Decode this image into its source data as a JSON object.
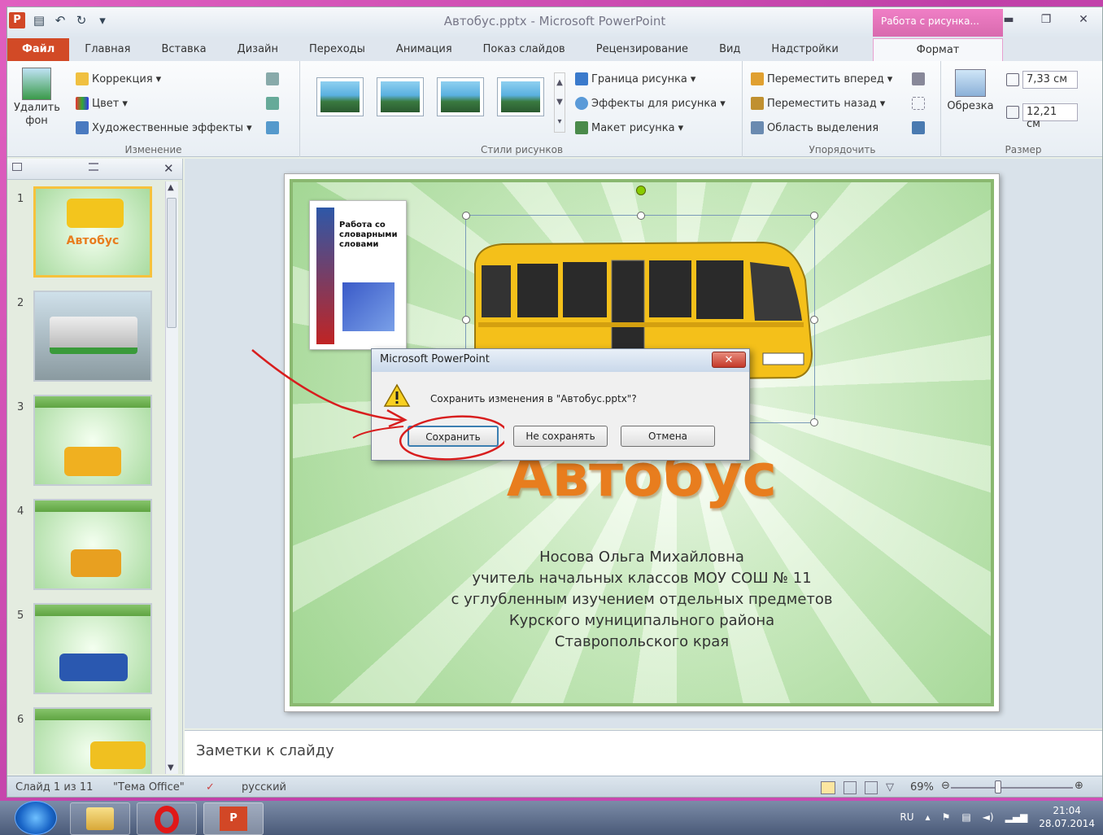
{
  "window": {
    "title": "Автобус.pptx - Microsoft PowerPoint",
    "context_tab_header": "Работа с рисунка..."
  },
  "tabs": [
    "Главная",
    "Вставка",
    "Дизайн",
    "Переходы",
    "Анимация",
    "Показ слайдов",
    "Рецензирование",
    "Вид",
    "Надстройки"
  ],
  "file_tab": "Файл",
  "format_tab": "Формат",
  "ribbon": {
    "remove_bg": "Удалить фон",
    "corrections": "Коррекция",
    "color": "Цвет",
    "art_effects": "Художественные эффекты",
    "group_adjust": "Изменение",
    "group_styles": "Стили рисунков",
    "picture_border": "Граница рисунка",
    "picture_effects": "Эффекты для рисунка",
    "picture_layout": "Макет рисунка",
    "bring_forward": "Переместить вперед",
    "send_backward": "Переместить назад",
    "selection_pane": "Область выделения",
    "group_arrange": "Упорядочить",
    "crop": "Обрезка",
    "height": "7,33 см",
    "width": "12,21 см",
    "group_size": "Размер"
  },
  "thumbnails": [
    "1",
    "2",
    "3",
    "4",
    "5",
    "6"
  ],
  "thumb1_title": "Автобус",
  "slide": {
    "book_title": "Работа со словарными словами",
    "title": "Автобус",
    "author_lines": [
      "Носова Ольга Михайловна",
      "учитель начальных классов МОУ СОШ № 11",
      "с углубленным изучением отдельных предметов",
      "Курского муниципального  района",
      "Ставропольского края"
    ]
  },
  "dialog": {
    "title": "Microsoft PowerPoint",
    "message": "Сохранить изменения в \"Автобус.pptx\"?",
    "save": "Сохранить",
    "dont_save": "Не сохранять",
    "cancel": "Отмена"
  },
  "notes_placeholder": "Заметки к слайду",
  "status": {
    "slide_count": "Слайд 1 из 11",
    "theme": "\"Тема Office\"",
    "language": "русский",
    "zoom": "69%"
  },
  "taskbar": {
    "lang": "RU",
    "time": "21:04",
    "date": "28.07.2014"
  },
  "colors": {
    "accent_file": "#d24a26",
    "context_pink": "#e070b8",
    "slide_title": "#e87d1e",
    "annotation_red": "#d81e1e"
  }
}
